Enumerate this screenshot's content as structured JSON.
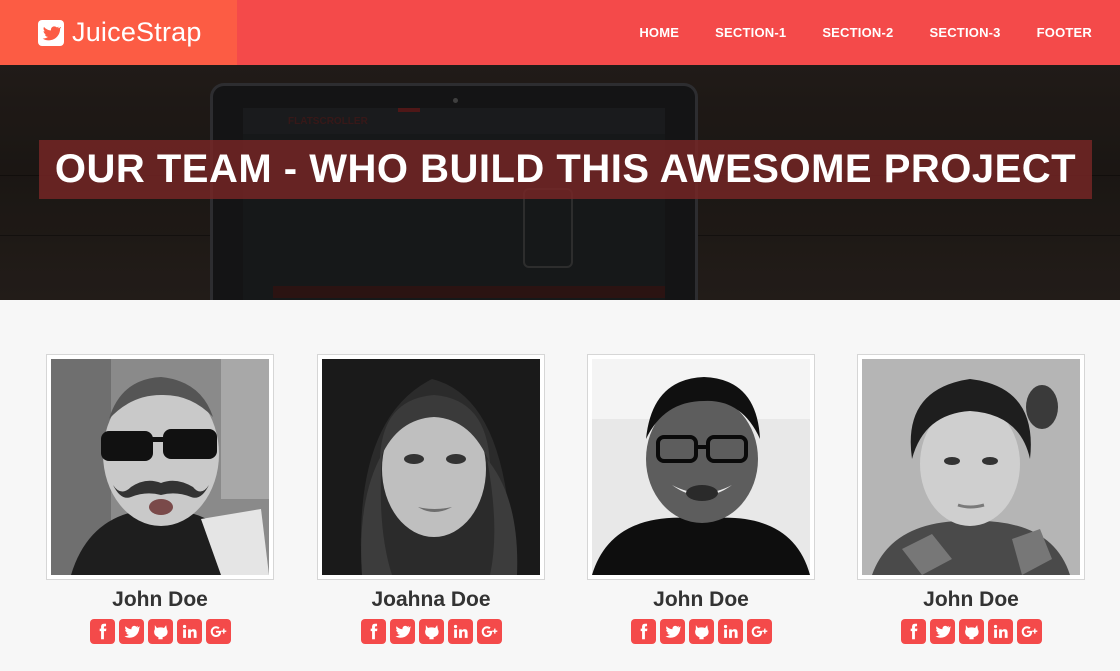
{
  "brand": {
    "name": "JuiceStrap",
    "icon": "twitter-icon"
  },
  "nav": {
    "items": [
      {
        "label": "HOME"
      },
      {
        "label": "SECTION-1"
      },
      {
        "label": "SECTION-2"
      },
      {
        "label": "SECTION-3"
      },
      {
        "label": "FOOTER"
      }
    ]
  },
  "hero": {
    "title": "OUR TEAM - WHO BUILD THIS AWESOME PROJECT",
    "screen_logo": "FLATSCROLLER"
  },
  "team": {
    "members": [
      {
        "name": "John Doe",
        "photo": "man-sunglasses-photo"
      },
      {
        "name": "Joahna Doe",
        "photo": "woman-portrait-photo"
      },
      {
        "name": "John Doe",
        "photo": "man-glasses-photo"
      },
      {
        "name": "John Doe",
        "photo": "young-man-photo"
      }
    ],
    "social_icons": [
      "facebook-icon",
      "twitter-icon",
      "github-icon",
      "linkedin-icon",
      "google-plus-icon"
    ]
  },
  "colors": {
    "primary": "#f44a4a",
    "brand_bg": "#fc5c44",
    "hero_title_bg": "#782626"
  }
}
